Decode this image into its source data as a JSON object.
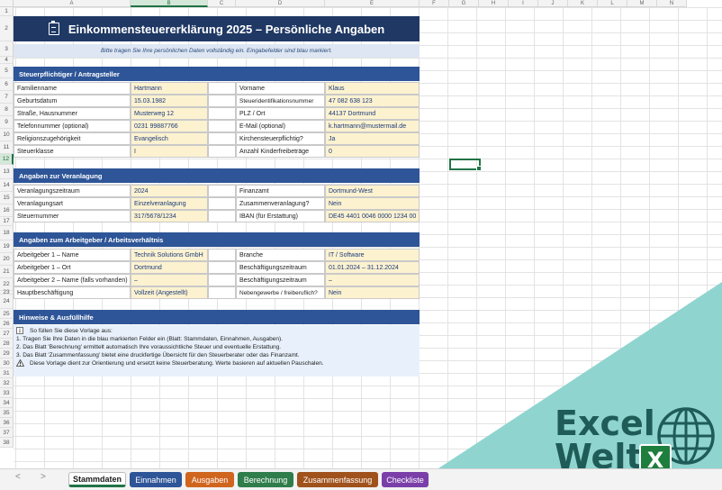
{
  "columns": [
    {
      "label": "A",
      "w": 130
    },
    {
      "label": "B",
      "w": 86,
      "selected": true
    },
    {
      "label": "C",
      "w": 31
    },
    {
      "label": "D",
      "w": 99
    },
    {
      "label": "E",
      "w": 105
    },
    {
      "label": "F",
      "w": 33
    },
    {
      "label": "G",
      "w": 33
    },
    {
      "label": "H",
      "w": 33
    },
    {
      "label": "I",
      "w": 33
    },
    {
      "label": "J",
      "w": 33
    },
    {
      "label": "K",
      "w": 33
    },
    {
      "label": "L",
      "w": 33
    },
    {
      "label": "M",
      "w": 33
    },
    {
      "label": "N",
      "w": 33
    }
  ],
  "rows": [
    "1",
    "2",
    "3",
    "4",
    "5",
    "6",
    "7",
    "8",
    "9",
    "10",
    "11",
    "12",
    "13",
    "14",
    "15",
    "16",
    "17",
    "18",
    "19",
    "20",
    "21",
    "22",
    "23",
    "24",
    "25",
    "26",
    "27",
    "28",
    "29",
    "30",
    "31",
    "32",
    "33",
    "34",
    "35",
    "36",
    "37",
    "38"
  ],
  "selected_row": "12",
  "header": {
    "title": "Einkommensteuererklärung 2025 – Persönliche Angaben",
    "subtitle": "Bitte tragen Sie Ihre persönlichen Daten vollständig ein. Eingabefelder sind blau markiert."
  },
  "sections": {
    "s1": {
      "title": "Steuerpflichtiger / Antragsteller",
      "rows": [
        {
          "l1": "Familienname",
          "v1": "Hartmann",
          "l2": "Vorname",
          "v2": "Klaus"
        },
        {
          "l1": "Geburtsdatum",
          "v1": "15.03.1982",
          "l2": "Steueridentifikationsnummer",
          "v2": "47 082 638 123"
        },
        {
          "l1": "Straße, Hausnummer",
          "v1": "Musterweg 12",
          "l2": "PLZ / Ort",
          "v2": "44137 Dortmund"
        },
        {
          "l1": "Telefonnummer (optional)",
          "v1": "0231 99887766",
          "l2": "E-Mail (optional)",
          "v2": "k.hartmann@mustermail.de"
        },
        {
          "l1": "Religionszugehörigkeit",
          "v1": "Evangelisch",
          "l2": "Kirchensteuerpflichtig?",
          "v2": "Ja"
        },
        {
          "l1": "Steuerklasse",
          "v1": "I",
          "l2": "Anzahl Kinderfreibeträge",
          "v2": "0"
        }
      ]
    },
    "s2": {
      "title": "Angaben zur Veranlagung",
      "rows": [
        {
          "l1": "Veranlagungszeitraum",
          "v1": "2024",
          "l2": "Finanzamt",
          "v2": "Dortmund-West"
        },
        {
          "l1": "Veranlagungsart",
          "v1": "Einzelveranlagung",
          "l2": "Zusammenveranlagung?",
          "v2": "Nein"
        },
        {
          "l1": "Steuernummer",
          "v1": "317/5678/1234",
          "l2": "IBAN (für Erstattung)",
          "v2": "DE45 4401 0046 0000 1234 00"
        }
      ]
    },
    "s3": {
      "title": "Angaben zum Arbeitgeber / Arbeitsverhältnis",
      "rows": [
        {
          "l1": "Arbeitgeber 1 – Name",
          "v1": "Technik Solutions GmbH",
          "l2": "Branche",
          "v2": "IT / Software"
        },
        {
          "l1": "Arbeitgeber 1 – Ort",
          "v1": "Dortmund",
          "l2": "Beschäftigungszeitraum",
          "v2": "01.01.2024 – 31.12.2024"
        },
        {
          "l1": "Arbeitgeber 2 – Name (falls vorhanden)",
          "v1": "–",
          "l2": "Beschäftigungszeitraum",
          "v2": "–"
        },
        {
          "l1": "Hauptbeschäftigung",
          "v1": "Vollzeit (Angestellt)",
          "l2": "Nebengewerbe / freiberuflich?",
          "v2": "Nein"
        }
      ]
    }
  },
  "hints": {
    "title": "Hinweise & Ausfüllhilfe",
    "info_icon": "info-icon",
    "warning_icon": "warning-icon",
    "lines": [
      "So füllen Sie diese Vorlage aus:",
      "1. Tragen Sie Ihre Daten in die blau markierten Felder ein (Blatt: Stammdaten, Einnahmen, Ausgaben).",
      "2. Das Blatt 'Berechnung' ermittelt automatisch Ihre voraussichtliche Steuer und eventuelle Erstattung.",
      "3. Das Blatt 'Zusammenfassung' bietet eine druckfertige Übersicht für den Steuerberater oder das Finanzamt.",
      "Diese Vorlage dient zur Orientierung und ersetzt keine Steuerberatung. Werte basieren auf aktuellen Pauschalen."
    ]
  },
  "tabs": [
    {
      "label": "Stammdaten",
      "color": "#ffffff",
      "active": true
    },
    {
      "label": "Einnahmen",
      "color": "#2e5597"
    },
    {
      "label": "Ausgaben",
      "color": "#d0651e"
    },
    {
      "label": "Berechnung",
      "color": "#2e7d4a"
    },
    {
      "label": "Zusammenfassung",
      "color": "#a0521c"
    },
    {
      "label": "Checkliste",
      "color": "#7a3fa8"
    }
  ],
  "nav": {
    "prev": "<",
    "next": ">"
  },
  "logo": {
    "line1": "Excel",
    "line2": "Welt",
    "badge": "X"
  },
  "colors": {
    "header_blue": "#1f3864",
    "section_blue": "#2e5597",
    "input_fill": "#fdf2d0",
    "accent_green": "#217346",
    "teal": "#8fd4cf"
  }
}
